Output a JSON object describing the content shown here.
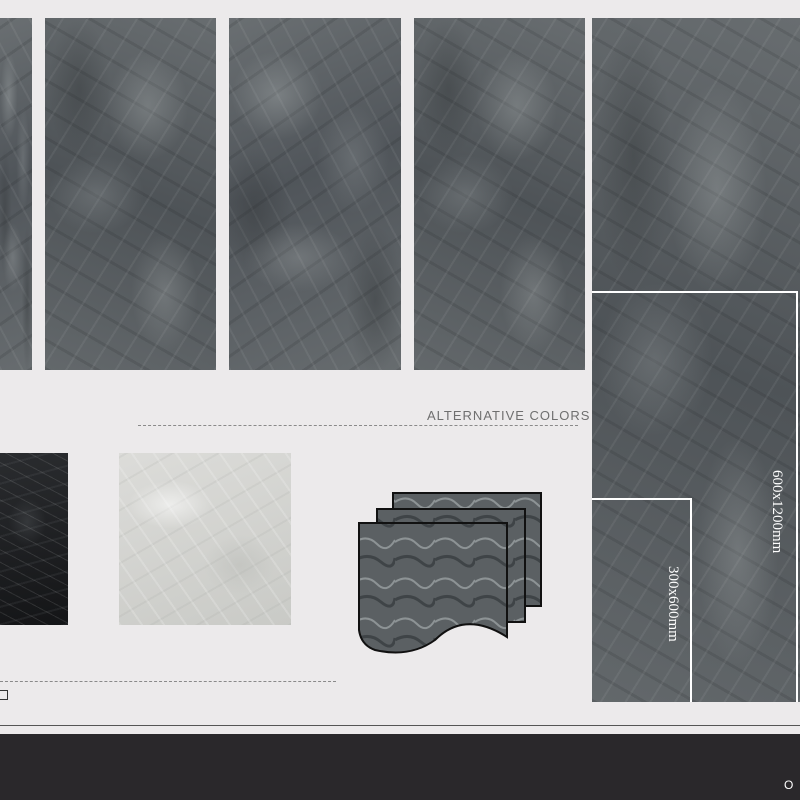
{
  "header": {
    "alternative_colors_label": "ALTERNATIVE COLORS"
  },
  "sizes": {
    "large_label": "600x1200mm",
    "small_label": "300x600mm"
  },
  "footer": {
    "text": "O"
  },
  "icons": {
    "corner_icon": "page-corner-icon",
    "stack_icon": "tile-stack-icon"
  },
  "colors": {
    "background": "#eceaeb",
    "footer": "#2a282b",
    "marble_dark": "#5b6063",
    "marble_black": "#1b1c1e",
    "marble_light": "#d4d5d2"
  }
}
